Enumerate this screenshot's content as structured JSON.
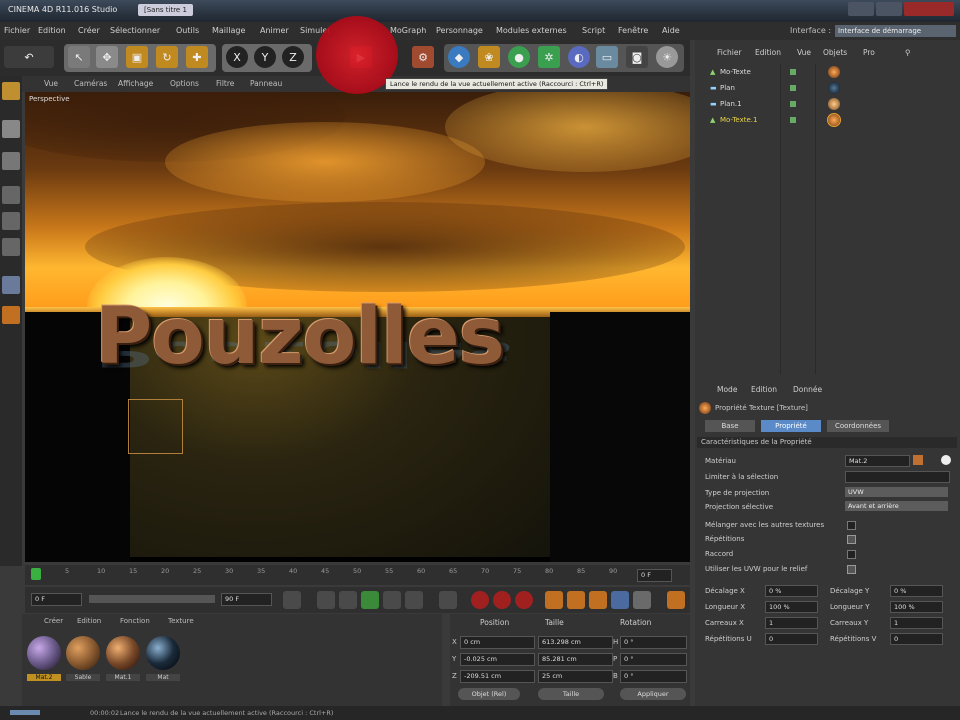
{
  "window": {
    "title": "CINEMA 4D R11.016 Studio",
    "doc_tab": "[Sans titre 1"
  },
  "menu": {
    "items": [
      "Fichier",
      "Edition",
      "Créer",
      "Sélectionner",
      "Outils",
      "Maillage",
      "Animer",
      "Simuler",
      "MoGraph",
      "Personnage",
      "Modules externes",
      "Script",
      "Fenêtre",
      "Aide"
    ],
    "layout_label": "Interface :",
    "layout_value": "Interface de démarrage"
  },
  "toolbar": {
    "axis_x": "X",
    "axis_y": "Y",
    "axis_z": "Z"
  },
  "tooltip": "Lance le rendu de la vue actuellement active (Raccourci : Ctrl+R)",
  "viewport": {
    "menu": [
      "Vue",
      "Caméras",
      "Affichage",
      "Options",
      "Filtre",
      "Panneau"
    ],
    "label": "Perspective",
    "scene_text": "Pouzolles"
  },
  "timeline": {
    "ticks": [
      "0",
      "5",
      "10",
      "15",
      "20",
      "25",
      "30",
      "35",
      "40",
      "45",
      "50",
      "55",
      "60",
      "65",
      "70",
      "75",
      "80",
      "85",
      "90"
    ],
    "end_field": "0 F"
  },
  "transport": {
    "current": "0 F",
    "end": "90 F"
  },
  "material_manager": {
    "menu": [
      "Créer",
      "Edition",
      "Fonction",
      "Texture"
    ],
    "materials": [
      {
        "label": "Mat.2",
        "color": "#6a5a8a"
      },
      {
        "label": "Sable",
        "color": "#8a5a30"
      },
      {
        "label": "Mat.1",
        "color": "#7a4a2a"
      },
      {
        "label": "Mat",
        "color": "#1a2a3a"
      }
    ]
  },
  "coords": {
    "headers": [
      "Position",
      "Taille",
      "Rotation"
    ],
    "rows": [
      {
        "axis": "X",
        "pos": "0 cm",
        "size": "613.298 cm",
        "rot": "H",
        "rotv": "0 °"
      },
      {
        "axis": "Y",
        "pos": "-0.025 cm",
        "size": "85.281 cm",
        "rot": "P",
        "rotv": "0 °"
      },
      {
        "axis": "Z",
        "pos": "-209.51 cm",
        "size": "25 cm",
        "rot": "B",
        "rotv": "0 °"
      }
    ],
    "mode": "Objet (Rel)",
    "size_mode": "Taille",
    "apply": "Appliquer"
  },
  "object_manager": {
    "menu": [
      "Fichier",
      "Edition",
      "Vue",
      "Objets",
      "Pro"
    ],
    "objects": [
      {
        "name": "Mo-Texte",
        "color": "#8fd46a",
        "tex": "#b06020"
      },
      {
        "name": "Plan",
        "color": "#8fd4ff",
        "tex": "#223344"
      },
      {
        "name": "Plan.1",
        "color": "#8fd4ff",
        "tex": "#cc8844"
      },
      {
        "name": "Mo-Texte.1",
        "color": "#d4c23a",
        "tex": "#aa6622"
      }
    ]
  },
  "attributes": {
    "menu": [
      "Mode",
      "Edition",
      "Donnée"
    ],
    "header": "Propriété Texture [Texture]",
    "tabs": [
      "Base",
      "Propriété",
      "Coordonnées"
    ],
    "section": "Caractéristiques de la Propriété",
    "material_label": "Matériau",
    "material_value": "Mat.2",
    "restrict_label": "Limiter à la sélection",
    "projection_label": "Type de projection",
    "projection_value": "UVW",
    "side_label": "Projection sélective",
    "side_value": "Avant et arrière",
    "mix_label": "Mélanger avec les autres textures",
    "tile_label": "Répétitions",
    "seamless_label": "Raccord",
    "uvw_label": "Utiliser les UVW pour le relief",
    "offset_u_label": "Décalage X",
    "offset_u_value": "0 %",
    "offset_v_label": "Décalage Y",
    "offset_v_value": "0 %",
    "length_u_label": "Longueur X",
    "length_u_value": "100 %",
    "length_v_label": "Longueur Y",
    "length_v_value": "100 %",
    "tiles_u_label": "Carreaux X",
    "tiles_u_value": "1",
    "tiles_v_label": "Carreaux Y",
    "tiles_v_value": "1",
    "rep_u_label": "Répétitions U",
    "rep_u_value": "0",
    "rep_v_label": "Répétitions V",
    "rep_v_value": "0"
  },
  "status": {
    "time": "00:00:02",
    "text": "Lance le rendu de la vue actuellement active (Raccourci : Ctrl+R)"
  }
}
